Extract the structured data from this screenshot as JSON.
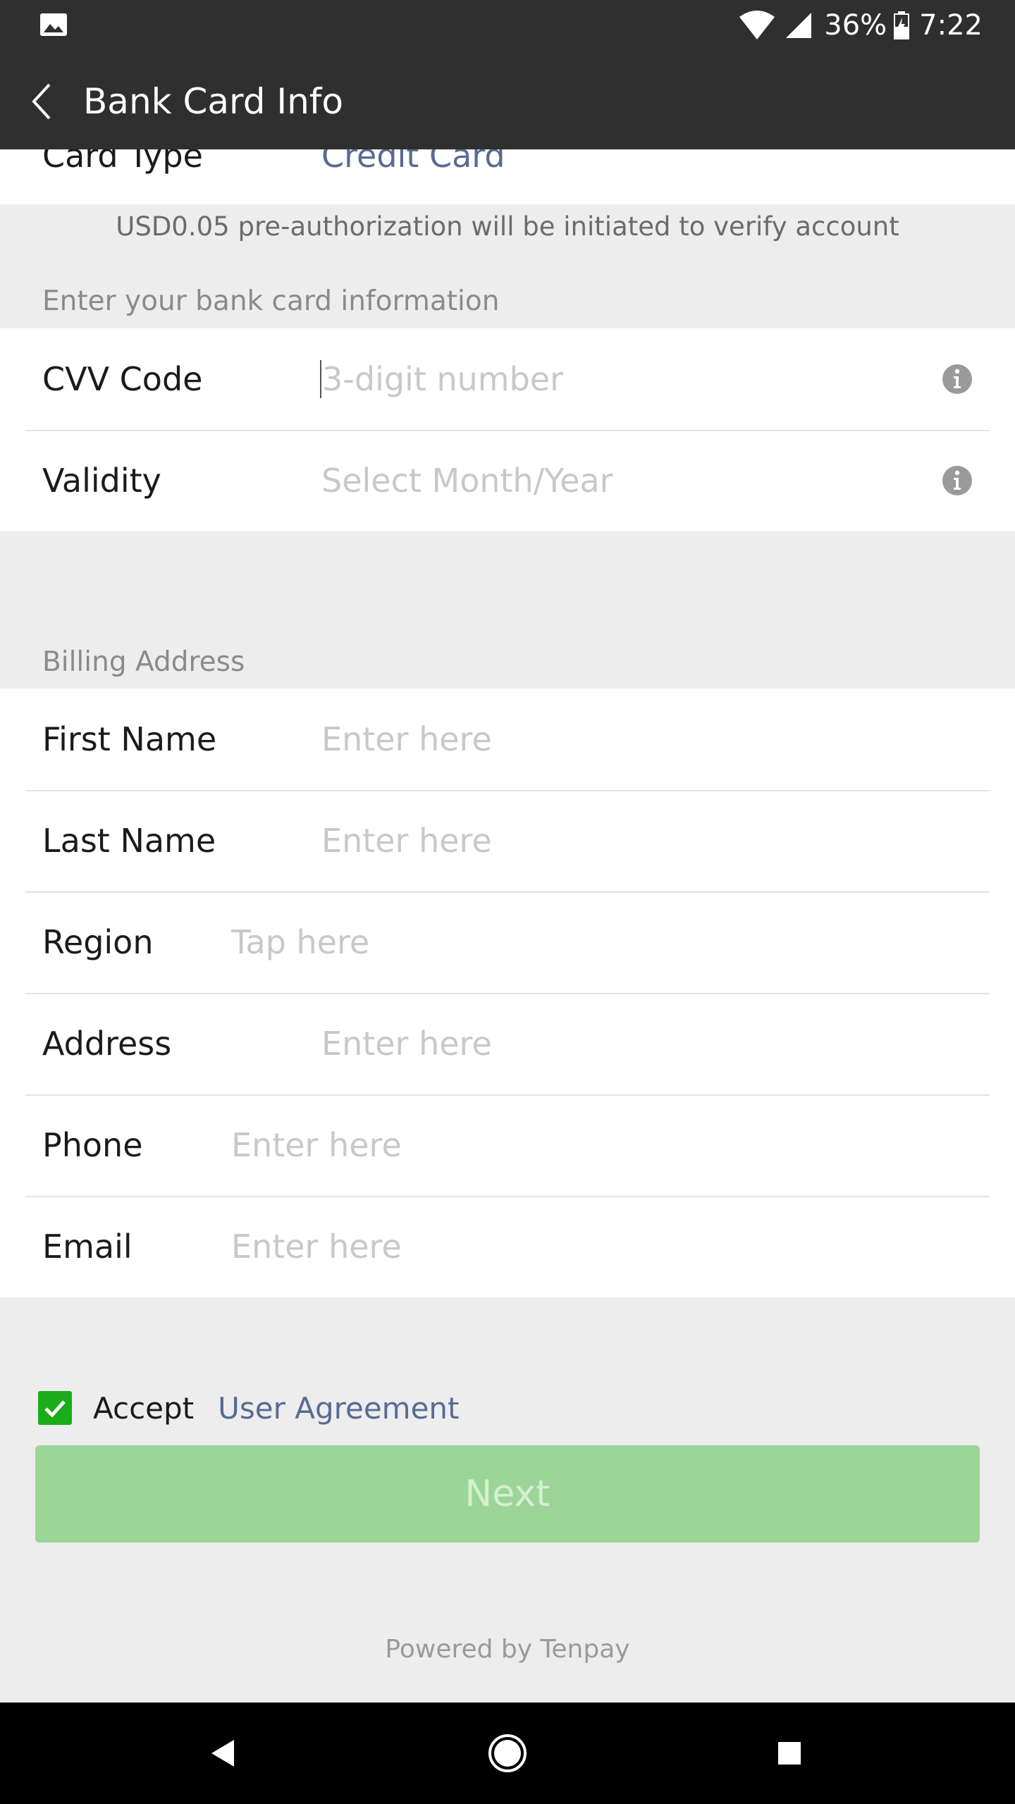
{
  "status_bar": {
    "battery": "36%",
    "time": "7:22",
    "icons": [
      "photo-icon",
      "wifi-icon",
      "cell-signal-icon",
      "battery-charging-icon"
    ]
  },
  "app_bar": {
    "title": "Bank Card Info",
    "back_icon": "back-chevron-icon"
  },
  "card_type": {
    "label": "Card Type",
    "value": "Credit Card"
  },
  "notice": "USD0.05 pre-authorization will be initiated to verify account",
  "card_info": {
    "header": "Enter your bank card information",
    "cvv": {
      "label": "CVV Code",
      "placeholder": "3-digit number"
    },
    "validity": {
      "label": "Validity",
      "placeholder": "Select Month/Year"
    }
  },
  "billing": {
    "header": "Billing Address",
    "first_name": {
      "label": "First Name",
      "placeholder": "Enter here"
    },
    "last_name": {
      "label": "Last Name",
      "placeholder": "Enter here"
    },
    "region": {
      "label": "Region",
      "placeholder": "Tap here"
    },
    "address": {
      "label": "Address",
      "placeholder": "Enter here"
    },
    "phone": {
      "label": "Phone",
      "placeholder": "Enter here"
    },
    "email": {
      "label": "Email",
      "placeholder": "Enter here"
    }
  },
  "agreement": {
    "accept_label": "Accept",
    "link": "User Agreement",
    "checked": true
  },
  "next_button": "Next",
  "footer": "Powered by Tenpay",
  "colors": {
    "header_bg": "#2f2f2f",
    "link": "#576b95",
    "accent_green": "#1aad19",
    "disabled_button": "#9bd597"
  }
}
